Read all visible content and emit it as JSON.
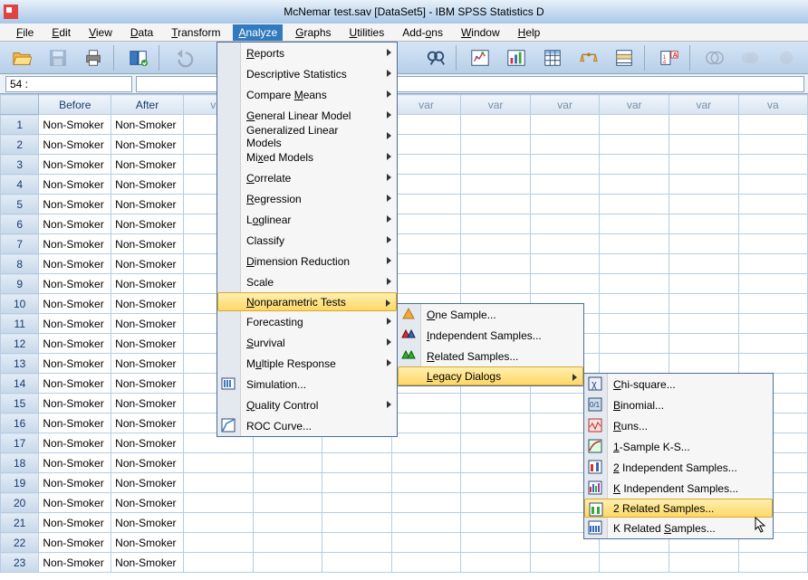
{
  "title": "McNemar test.sav [DataSet5] - IBM SPSS Statistics D",
  "menubar": [
    "File",
    "Edit",
    "View",
    "Data",
    "Transform",
    "Analyze",
    "Graphs",
    "Utilities",
    "Add-ons",
    "Window",
    "Help"
  ],
  "menubar_active_index": 5,
  "namebox": "54 :",
  "columns": [
    "Before",
    "After",
    "var",
    "var",
    "var",
    "var",
    "var",
    "var",
    "var",
    "var",
    "va"
  ],
  "rows": [
    1,
    2,
    3,
    4,
    5,
    6,
    7,
    8,
    9,
    10,
    11,
    12,
    13,
    14,
    15,
    16,
    17,
    18,
    19,
    20,
    21,
    22,
    23
  ],
  "cell_value": "Non-Smoker",
  "analyze_menu": [
    {
      "label": "Reports",
      "sub": true
    },
    {
      "label": "Descriptive Statistics",
      "sub": true
    },
    {
      "label": "Compare Means",
      "sub": true
    },
    {
      "label": "General Linear Model",
      "sub": true
    },
    {
      "label": "Generalized Linear Models",
      "sub": true
    },
    {
      "label": "Mixed Models",
      "sub": true
    },
    {
      "label": "Correlate",
      "sub": true
    },
    {
      "label": "Regression",
      "sub": true
    },
    {
      "label": "Loglinear",
      "sub": true
    },
    {
      "label": "Classify",
      "sub": true
    },
    {
      "label": "Dimension Reduction",
      "sub": true
    },
    {
      "label": "Scale",
      "sub": true
    },
    {
      "label": "Nonparametric Tests",
      "sub": true,
      "hl": true
    },
    {
      "label": "Forecasting",
      "sub": true
    },
    {
      "label": "Survival",
      "sub": true
    },
    {
      "label": "Multiple Response",
      "sub": true
    },
    {
      "label": "Simulation...",
      "icon": "sim"
    },
    {
      "label": "Quality Control",
      "sub": true
    },
    {
      "label": "ROC Curve...",
      "icon": "roc"
    }
  ],
  "nonparam_menu": [
    {
      "label": "One Sample...",
      "icon": "tri"
    },
    {
      "label": "Independent Samples...",
      "icon": "tri2"
    },
    {
      "label": "Related Samples...",
      "icon": "tri3"
    },
    {
      "label": "Legacy Dialogs",
      "sub": true,
      "hl": true
    }
  ],
  "legacy_menu": [
    {
      "label": "Chi-square...",
      "icon": "chi"
    },
    {
      "label": "Binomial...",
      "icon": "bin"
    },
    {
      "label": "Runs...",
      "icon": "run"
    },
    {
      "label": "1-Sample K-S...",
      "icon": "ks"
    },
    {
      "label": "2 Independent Samples...",
      "icon": "2i"
    },
    {
      "label": "K Independent Samples...",
      "icon": "ki"
    },
    {
      "label": "2 Related Samples...",
      "icon": "2r",
      "hl": true
    },
    {
      "label": "K Related Samples...",
      "icon": "kr"
    }
  ]
}
